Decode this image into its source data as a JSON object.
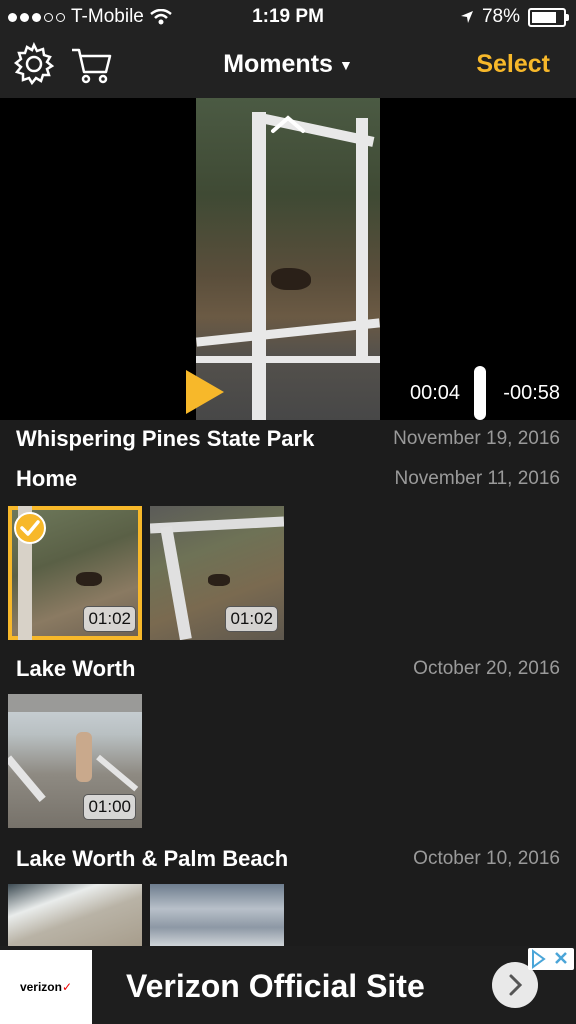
{
  "status": {
    "carrier": "T-Mobile",
    "time": "1:19 PM",
    "battery": "78%"
  },
  "nav": {
    "title": "Moments",
    "select_label": "Select",
    "icons": [
      "gear-icon",
      "cart-icon",
      "caret-down-icon"
    ]
  },
  "player": {
    "elapsed": "00:04",
    "remaining": "-00:58"
  },
  "sections": [
    {
      "name": "Whispering Pines State Park",
      "date": "November 19, 2016"
    },
    {
      "name": "Home",
      "date": "November 11, 2016",
      "items": [
        {
          "duration": "01:02",
          "selected": true
        },
        {
          "duration": "01:02",
          "selected": false
        }
      ]
    },
    {
      "name": "Lake Worth",
      "date": "October 20, 2016",
      "items": [
        {
          "duration": "01:00",
          "selected": false
        }
      ]
    },
    {
      "name": "Lake Worth & Palm Beach",
      "date": "October 10, 2016"
    }
  ],
  "ad": {
    "brand": "verizon",
    "headline": "Verizon Official Site"
  },
  "colors": {
    "accent": "#f7b82a",
    "background": "#1c1c1c",
    "bar": "#222222"
  }
}
